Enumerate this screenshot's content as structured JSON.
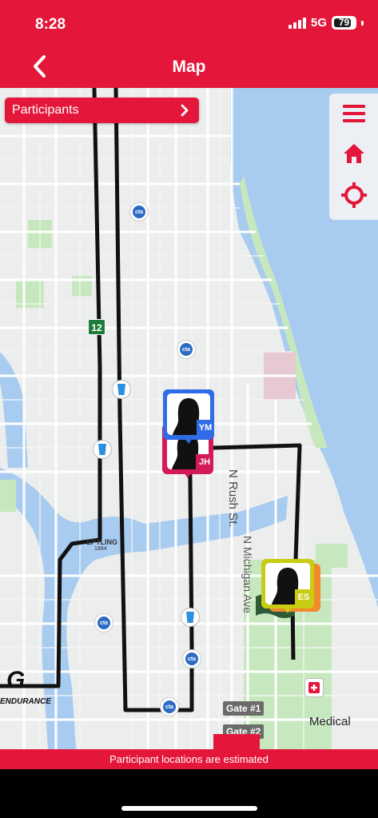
{
  "status_bar": {
    "time": "8:28",
    "network": "5G",
    "battery": "79",
    "battery_level": 0.79
  },
  "header": {
    "title": "Map",
    "back_icon": "chevron-left-icon"
  },
  "participants_button": {
    "label": "Participants",
    "icon": "chevron-right-icon"
  },
  "toolbar": {
    "items": [
      "menu-icon",
      "home-icon",
      "locate-icon"
    ]
  },
  "colors": {
    "brand": "#E4163A",
    "water": "#A8CBF0",
    "park": "#C7E8BE",
    "route": "#111111"
  },
  "markers": [
    {
      "initials": "YM",
      "color": "#2F6CE5"
    },
    {
      "initials": "JH",
      "color": "#D4195A"
    },
    {
      "initials": "ES",
      "color": "#C8CC12"
    }
  ],
  "map_labels": {
    "street_rush": "N Rush St.",
    "street_michigan": "N Michigan Ave",
    "route_number": "12",
    "landmark": "EPTLING",
    "landmark_year": "1884",
    "sponsor_letter": "G",
    "sponsor_name": "ENDURANCE",
    "medical": "Medical",
    "gate1": "Gate #1",
    "gate2": "Gate #2",
    "cta": "cta"
  },
  "footer": {
    "notice": "Participant locations are estimated"
  }
}
